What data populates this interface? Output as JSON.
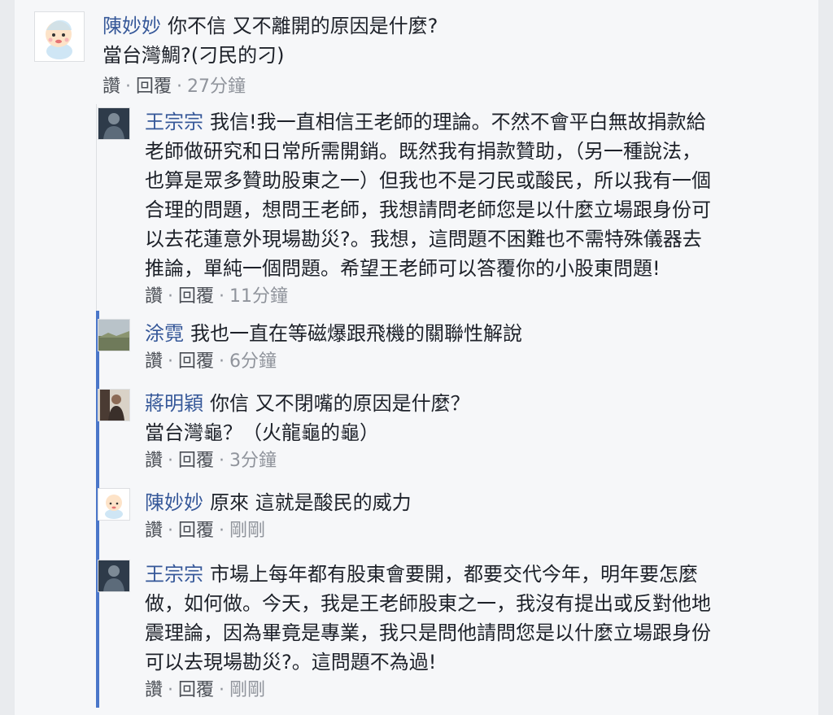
{
  "comments": [
    {
      "name": "陳妙妙",
      "lines": [
        "你不信 又不離開的原因是什麼?",
        "當台灣鯛?(刁民的刁)"
      ],
      "like": "讚",
      "reply": "回覆",
      "time": "27分鐘"
    },
    {
      "name": "王宗宗",
      "lines": [
        "我信!我一直相信王老師的理論。不然不會平白無故捐款給",
        "老師做研究和日常所需開銷。既然我有捐款贊助，（另一種說法，",
        "也算是眾多贊助股東之一）但我也不是刁民或酸民，所以我有一個",
        "合理的問題，想問王老師，我想請問老師您是以什麼立場跟身份可",
        "以去花蓮意外現場勘災?。我想，這問題不困難也不需特殊儀器去",
        "推論，單純一個問題。希望王老師可以答覆你的小股東問題!"
      ],
      "like": "讚",
      "reply": "回覆",
      "time": "11分鐘"
    },
    {
      "name": "涂霓",
      "lines": [
        "我也一直在等磁爆跟飛機的關聯性解說"
      ],
      "like": "讚",
      "reply": "回覆",
      "time": "6分鐘"
    },
    {
      "name": "蔣明穎",
      "lines": [
        "你信 又不閉嘴的原因是什麼？",
        "當台灣龜？（火龍龜的龜）"
      ],
      "like": "讚",
      "reply": "回覆",
      "time": "3分鐘"
    },
    {
      "name": "陳妙妙",
      "lines": [
        "原來 這就是酸民的威力"
      ],
      "like": "讚",
      "reply": "回覆",
      "time": "剛剛"
    },
    {
      "name": "王宗宗",
      "lines": [
        "市場上每年都有股東會要開，都要交代今年，明年要怎麼",
        "做，如何做。今天，我是王老師股東之一，我沒有提出或反對他地",
        "震理論，因為畢竟是專業，我只是問他請問您是以什麼立場跟身份",
        "可以去現場勘災?。這問題不為過!"
      ],
      "like": "讚",
      "reply": "回覆",
      "time": "剛剛"
    }
  ]
}
